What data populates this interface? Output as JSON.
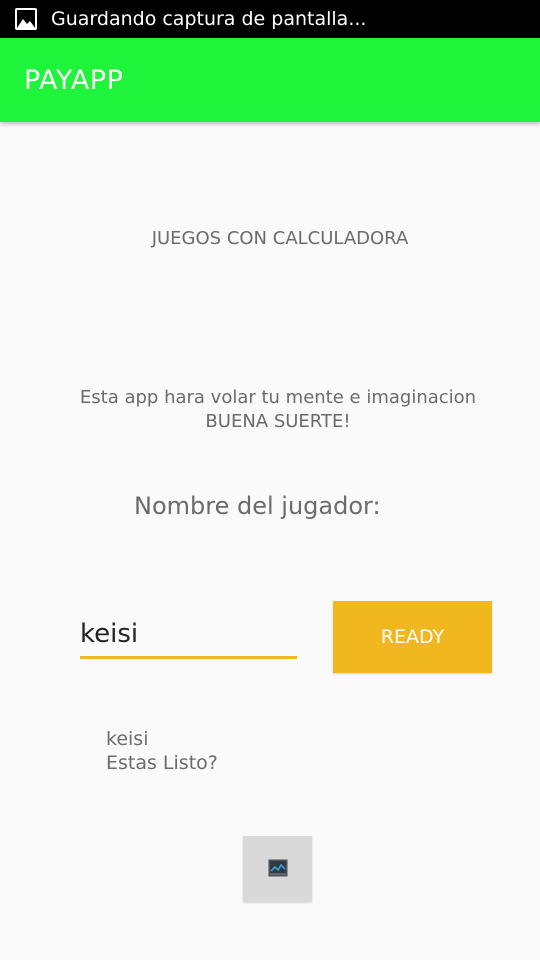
{
  "status_bar": {
    "notification_icon": "image-icon",
    "text": "Guardando captura de pantalla..."
  },
  "app_bar": {
    "title": "PAYAPP",
    "color": "#1ef53a"
  },
  "main": {
    "heading": "JUEGOS CON CALCULADORA",
    "intro_line1": "Esta app hara volar tu mente e imaginacion",
    "intro_line2": "BUENA SUERTE!",
    "player_label": "Nombre del jugador:",
    "name_input_value": "keisi",
    "ready_button_label": "READY",
    "accent_color": "#f0b81e",
    "result_name": "keisi",
    "result_question": "Estas Listo?",
    "image_button_icon": "broken-image-icon"
  }
}
